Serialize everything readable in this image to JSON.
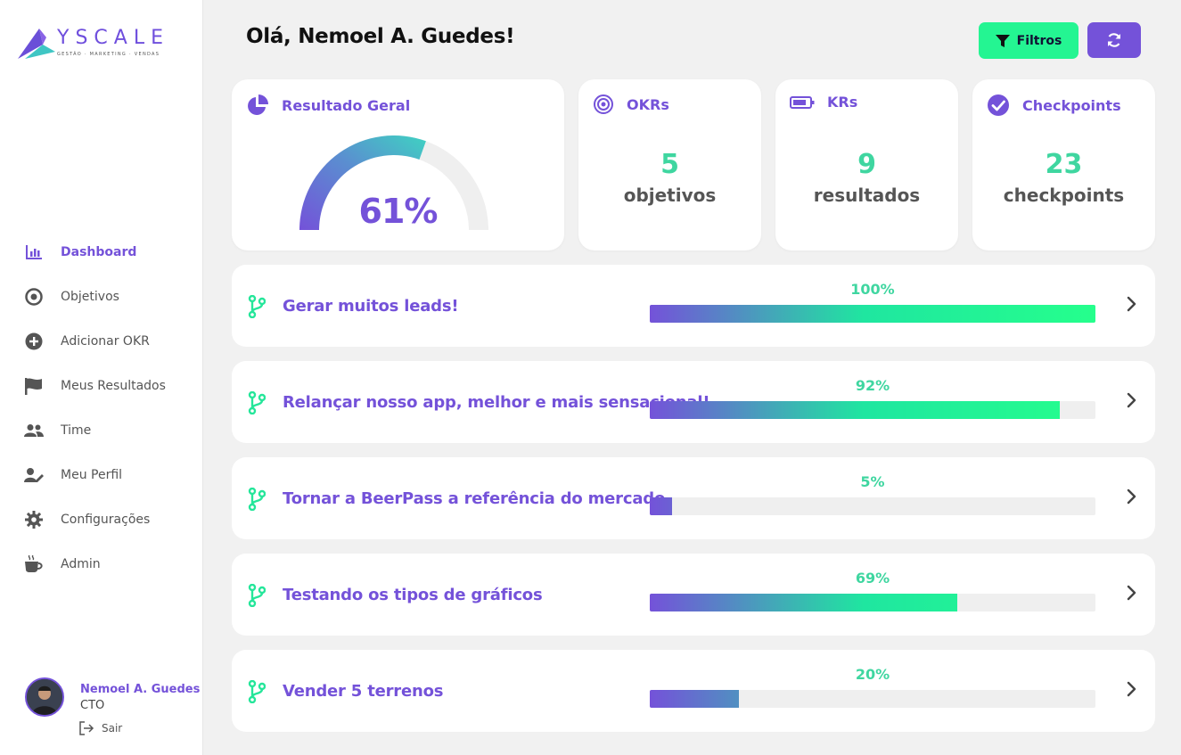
{
  "brand": {
    "name": "YSCALE",
    "tagline": "GESTÃO · MARKETING · VENDAS"
  },
  "sidebar": {
    "items": [
      {
        "label": "Dashboard",
        "icon": "bar-chart-icon",
        "active": true
      },
      {
        "label": "Objetivos",
        "icon": "target-icon",
        "active": false
      },
      {
        "label": "Adicionar OKR",
        "icon": "plus-circle-icon",
        "active": false
      },
      {
        "label": "Meus Resultados",
        "icon": "flag-icon",
        "active": false
      },
      {
        "label": "Time",
        "icon": "users-icon",
        "active": false
      },
      {
        "label": "Meu Perfil",
        "icon": "user-edit-icon",
        "active": false
      },
      {
        "label": "Configurações",
        "icon": "gear-icon",
        "active": false
      },
      {
        "label": "Admin",
        "icon": "coffee-icon",
        "active": false
      }
    ]
  },
  "user": {
    "name": "Nemoel A. Guedes",
    "role": "CTO",
    "logout_label": "Sair"
  },
  "header": {
    "greeting": "Olá, Nemoel A. Guedes!",
    "filter_label": "Filtros"
  },
  "stats": {
    "geral": {
      "title": "Resultado Geral",
      "value": "61%",
      "fraction": 0.61
    },
    "okrs": {
      "title": "OKRs",
      "number": "5",
      "unit": "objetivos"
    },
    "krs": {
      "title": "KRs",
      "number": "9",
      "unit": "resultados"
    },
    "checkpoints": {
      "title": "Checkpoints",
      "number": "23",
      "unit": "checkpoints"
    }
  },
  "okrs": [
    {
      "name": "Gerar muitos leads!",
      "percent_label": "100%",
      "progress": 1.0
    },
    {
      "name": "Relançar nosso app, melhor e mais sensacional!",
      "percent_label": "92%",
      "progress": 0.92
    },
    {
      "name": "Tornar a BeerPass a referência do mercado",
      "percent_label": "5%",
      "progress": 0.05
    },
    {
      "name": "Testando os tipos de gráficos",
      "percent_label": "69%",
      "progress": 0.69
    },
    {
      "name": "Vender 5 terrenos",
      "percent_label": "20%",
      "progress": 0.2
    }
  ],
  "colors": {
    "accent": "#7452d9",
    "success": "#24f592",
    "number": "#3fd6a0"
  }
}
